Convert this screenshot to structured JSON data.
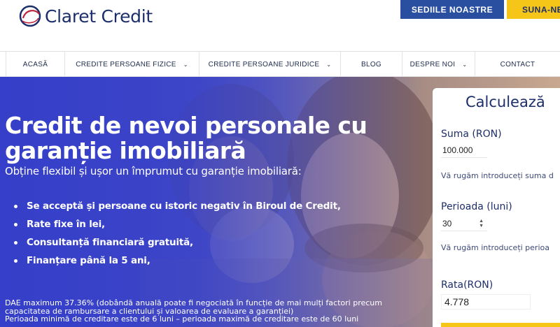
{
  "header": {
    "brand": "Claret Credit",
    "btn_sedii": "SEDIILE NOASTRE",
    "btn_suna": "SUNA-NE"
  },
  "nav": {
    "items": [
      {
        "label": "ACASĂ"
      },
      {
        "label": "CREDITE PERSOANE FIZICE"
      },
      {
        "label": "CREDITE PERSOANE JURIDICE"
      },
      {
        "label": "BLOG"
      },
      {
        "label": "DESPRE NOI"
      },
      {
        "label": "CONTACT"
      }
    ]
  },
  "hero": {
    "title": "Credit de nevoi personale cu garanție imobiliară",
    "subtitle": "Obține flexibil și ușor un împrumut cu garanție imobiliară:",
    "bullets": [
      "Se acceptă și persoane cu istoric negativ în Biroul de Credit,",
      "Rate fixe în lei,",
      "Consultanță financiară gratuită,",
      "Finanțare până la 5 ani,"
    ],
    "disclaimer_1": "DAE maximum 37.36% (dobândă anuală poate fi negociată în funcție de mai mulți factori precum capacitatea de rambursare a clientului și valoarea de evaluare a garanției)",
    "disclaimer_2": "Perioada minimă de creditare este de 6 luni – perioada maximă de creditare este de 60 luni"
  },
  "calculator": {
    "title": "Calculează",
    "suma_label": "Suma (RON)",
    "suma_value": "100.000",
    "suma_hint": "Vă rugăm introduceți suma d",
    "perioada_label": "Perioada (luni)",
    "perioada_value": "30",
    "perioada_hint": "Vă rugăm introduceți perioa",
    "rata_label": "Rata(RON)",
    "rata_value": "4.778"
  },
  "colors": {
    "brand_navy": "#1d2f6b",
    "button_blue": "#2a4fa0",
    "accent_yellow": "#f5c518",
    "hero_blue": "#3a44c6"
  },
  "icons": [
    "claret-logo-icon",
    "chevron-down-icon",
    "stepper-icon"
  ]
}
